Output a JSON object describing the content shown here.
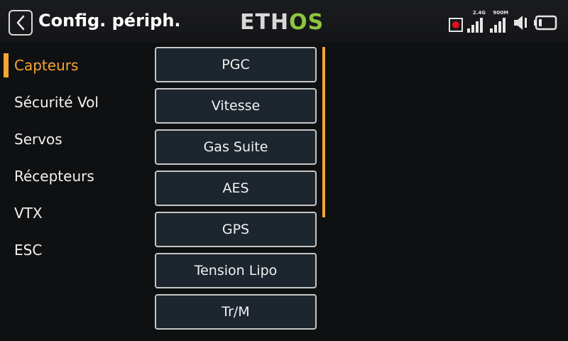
{
  "header": {
    "title": "Config. périph.",
    "logo_left": "ETH",
    "logo_right": "OS",
    "signal_1_label": "2.4G",
    "signal_2_label": "900M"
  },
  "sidebar": {
    "items": [
      {
        "label": "Capteurs",
        "active": true
      },
      {
        "label": "Sécurité Vol",
        "active": false
      },
      {
        "label": "Servos",
        "active": false
      },
      {
        "label": "Récepteurs",
        "active": false
      },
      {
        "label": "VTX",
        "active": false
      },
      {
        "label": "ESC",
        "active": false
      }
    ]
  },
  "list": {
    "items": [
      "PGC",
      "Vitesse",
      "Gas Suite",
      "AES",
      "GPS",
      "Tension Lipo",
      "Tr/M"
    ]
  },
  "colors": {
    "accent": "#f7a534",
    "logo_green": "#8cc63f",
    "record_red": "#e0101e",
    "button_bg": "#1d262e"
  },
  "icons": [
    "back-arrow-icon",
    "record-icon",
    "signal-icon",
    "speaker-icon",
    "battery-icon"
  ]
}
